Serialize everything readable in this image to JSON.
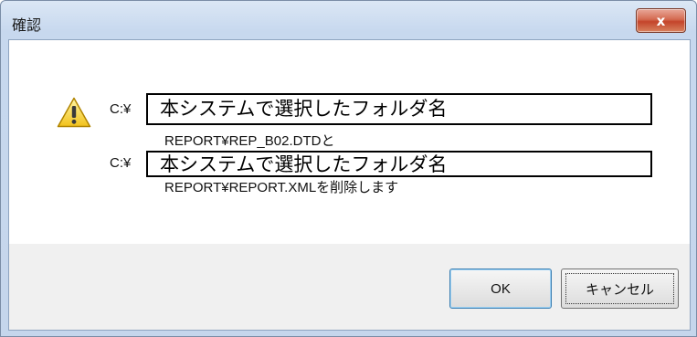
{
  "window": {
    "title": "確認",
    "close_label": "x"
  },
  "message": {
    "line1_prefix": "C:¥",
    "line1_folder": "本システムで選択したフォルダ名",
    "line2": "REPORT¥REP_B02.DTDと",
    "line3_prefix": "C:¥",
    "line3_folder": "本システムで選択したフォルダ名",
    "line4": "REPORT¥REPORT.XMLを削除します",
    "icon": "warning-icon"
  },
  "buttons": {
    "ok_label": "OK",
    "cancel_label": "キャンセル"
  }
}
